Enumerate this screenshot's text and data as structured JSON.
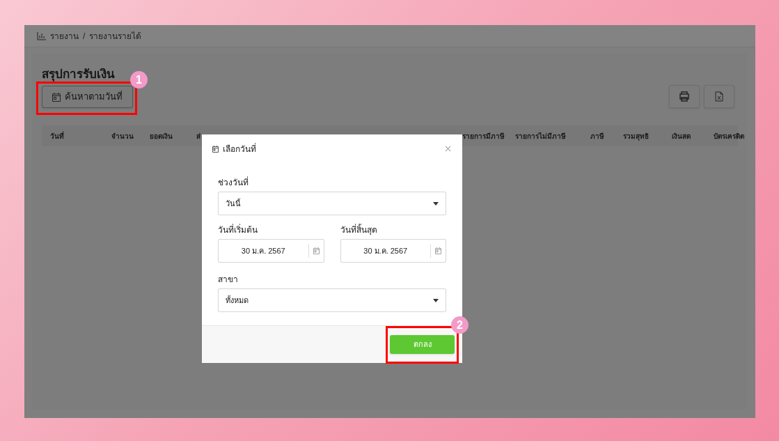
{
  "breadcrumb": [
    "รายงาน",
    "/",
    "รายงานรายได้"
  ],
  "page": {
    "title": "สรุปการรับเงิน",
    "search_button": "ค้นหาตามวันที่"
  },
  "table": {
    "columns": [
      "วันที่",
      "จำนวน",
      "ยอดเงิน",
      "ส่",
      "รายการมีภาษี",
      "รายการไม่มีภาษี",
      "ภาษี",
      "รวมสุทธิ",
      "เงินสด",
      "บัตรเครดิต"
    ]
  },
  "dialog": {
    "title": "เลือกวันที่",
    "range_label": "ช่วงวันที่",
    "range_value": "วันนี้",
    "start_label": "วันที่เริ่มต้น",
    "start_value": "30 ม.ค. 2567",
    "end_label": "วันที่สิ้นสุด",
    "end_value": "30 ม.ค. 2567",
    "branch_label": "สาขา",
    "branch_value": "ทั้งหมด",
    "ok_button": "ตกลง"
  },
  "annotations": [
    {
      "number": "1"
    },
    {
      "number": "2"
    }
  ]
}
